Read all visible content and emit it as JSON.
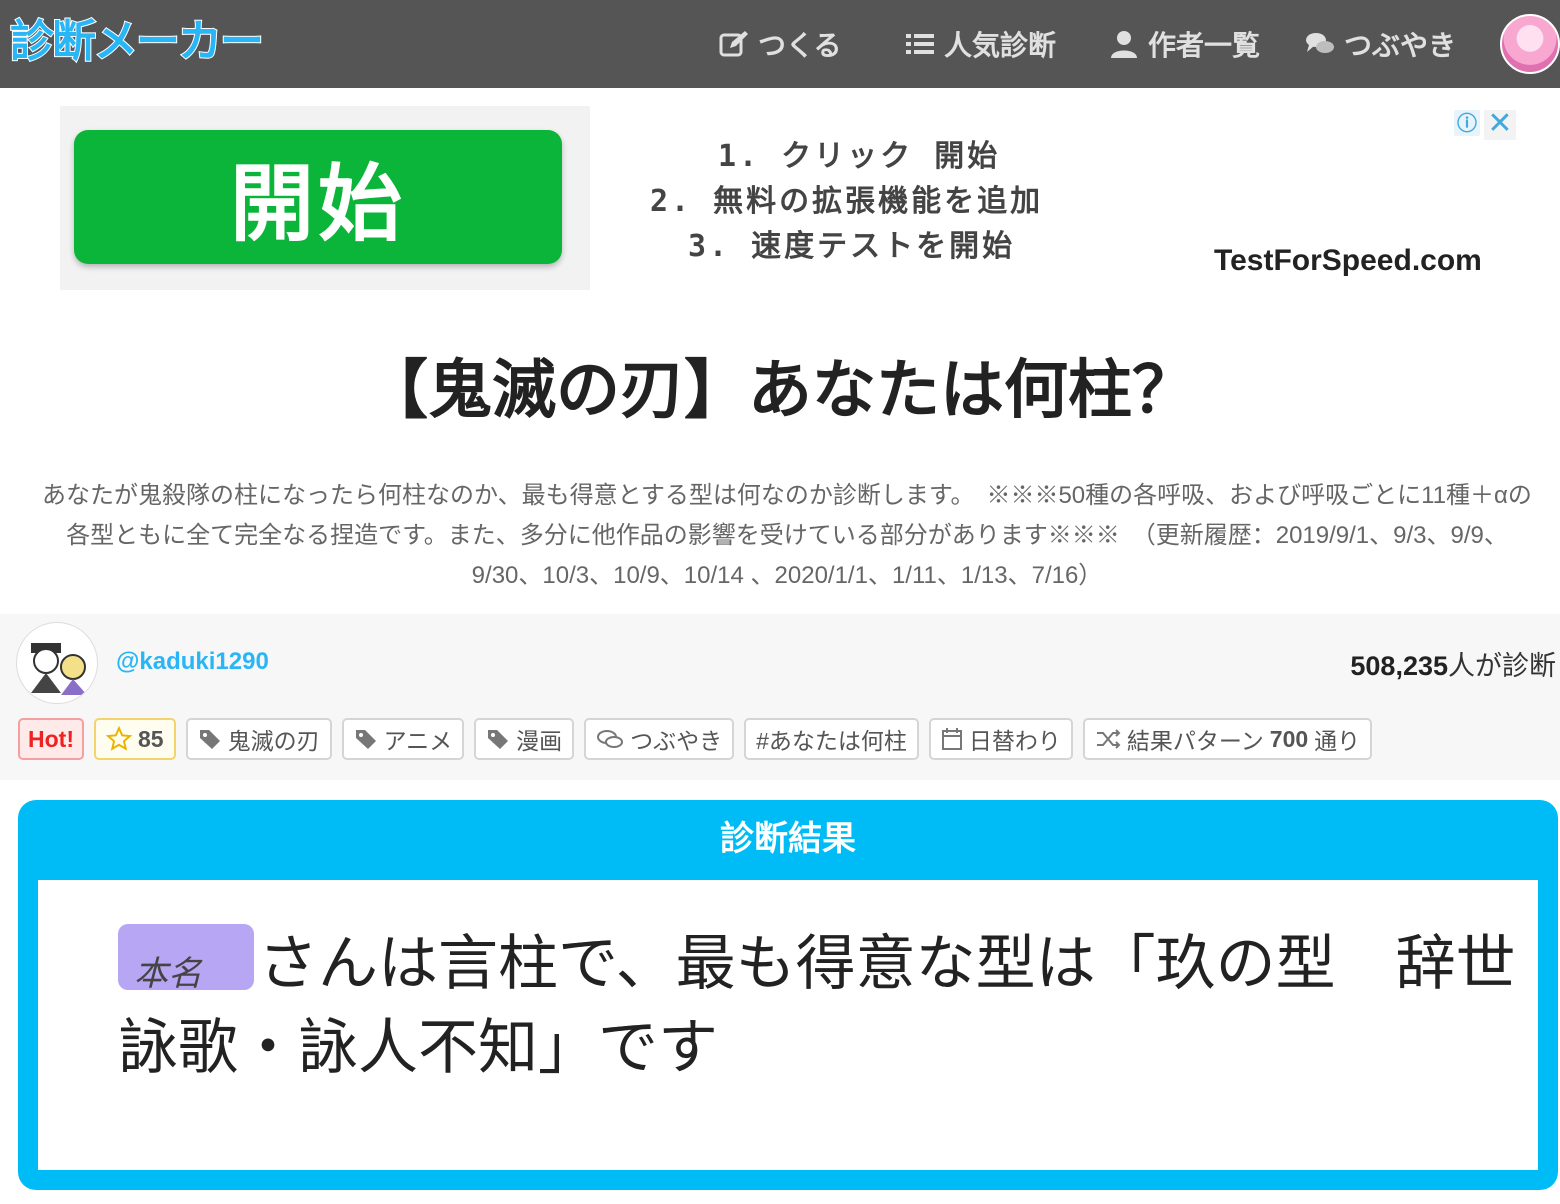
{
  "header": {
    "logo": "診断メーカー",
    "nav": [
      {
        "label": "つくる",
        "icon": "edit-icon"
      },
      {
        "label": "人気診断",
        "icon": "list-icon"
      },
      {
        "label": "作者一覧",
        "icon": "user-icon"
      },
      {
        "label": "つぶやき",
        "icon": "chat-icon"
      }
    ]
  },
  "ad": {
    "button_label": "開始",
    "steps": [
      "1. クリック 開始",
      "2. 無料の拡張機能を追加",
      "3. 速度テストを開始"
    ],
    "domain": "TestForSpeed.com",
    "info_symbol": "ⓘ",
    "close_symbol": "✕"
  },
  "diagnosis": {
    "title": "【鬼滅の刃】あなたは何柱？",
    "description": "あなたが鬼殺隊の柱になったら何柱なのか、最も得意とする型は何なのか診断します。　※※※50種の各呼吸、および呼吸ごとに11種＋αの各型ともに全て完全なる捏造です。また、多分に他作品の影響を受けている部分があります※※※　（更新履歴：2019/9/1、9/3、9/9、9/30、10/3、10/9、10/14 、2020/1/1、1/11、1/13、7/16）"
  },
  "author": {
    "handle": "@kaduki1290",
    "count_number": "508,235",
    "count_suffix": "人が診断"
  },
  "tags": {
    "hot": "Hot!",
    "star_count": "85",
    "tag1": "鬼滅の刃",
    "tag2": "アニメ",
    "tag3": "漫画",
    "tweet": "つぶやき",
    "hashtag": "#あなたは何柱",
    "daily": "日替わり",
    "patterns_prefix": "結果パターン",
    "patterns_count": "700",
    "patterns_suffix": "通り"
  },
  "result": {
    "heading": "診断結果",
    "redacted_name": "本名",
    "text": "さんは言柱で、最も得意な型は「玖の型　辞世詠歌・詠人不知」です"
  },
  "colors": {
    "header_bg": "#555555",
    "accent": "#00bcf6",
    "ad_green": "#0bb53a",
    "redact": "#b7a6f4"
  }
}
